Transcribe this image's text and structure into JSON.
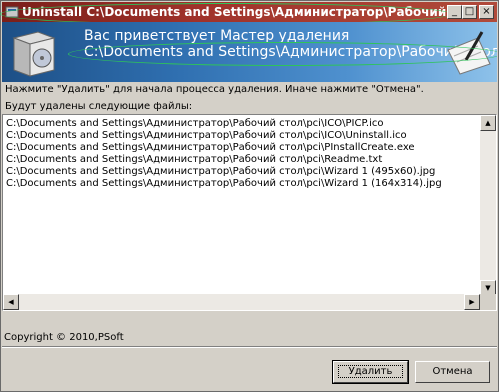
{
  "window": {
    "title": "Uninstall C:\\Documents and Settings\\Администратор\\Рабочий с..."
  },
  "banner": {
    "line1": "Вас приветствует Мастер удаления",
    "line2": "C:\\Documents and Settings\\Администратор\\Рабочий стол\\pci"
  },
  "instruction": "Нажмите \"Удалить\" для начала процесса удаления. Иначе нажмите \"Отмена\".",
  "files_label": "Будут удалены следующие файлы:",
  "files": [
    "C:\\Documents and Settings\\Администратор\\Рабочий стол\\pci\\ICO\\PICP.ico",
    "C:\\Documents and Settings\\Администратор\\Рабочий стол\\pci\\ICO\\Uninstall.ico",
    "C:\\Documents and Settings\\Администратор\\Рабочий стол\\pci\\PInstallCreate.exe",
    "C:\\Documents and Settings\\Администратор\\Рабочий стол\\pci\\Readme.txt",
    "C:\\Documents and Settings\\Администратор\\Рабочий стол\\pci\\Wizard 1 (495x60).jpg",
    "C:\\Documents and Settings\\Администратор\\Рабочий стол\\pci\\Wizard 1 (164x314).jpg"
  ],
  "copyright": "Copyright © 2010,PSoft",
  "buttons": {
    "delete": "Удалить",
    "cancel": "Отмена"
  }
}
